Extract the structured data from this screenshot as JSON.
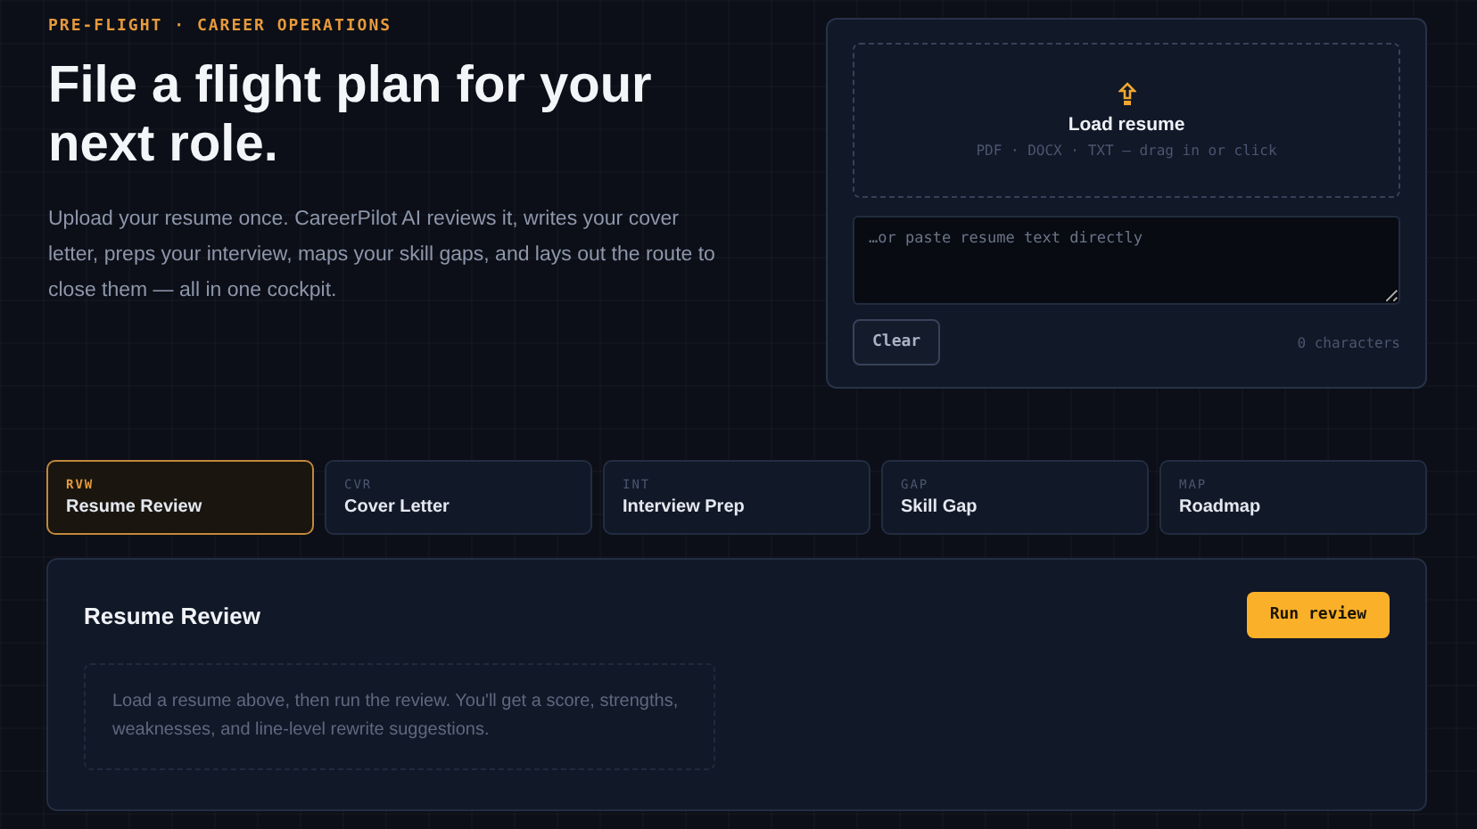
{
  "hero": {
    "eyebrow": "PRE-FLIGHT · CAREER OPERATIONS",
    "title": "File a flight plan for your next role.",
    "intro": "Upload your resume once. CareerPilot AI reviews it, writes your cover letter, preps your interview, maps your skill gaps, and lays out the route to close them — all in one cockpit."
  },
  "upload": {
    "title": "Load resume",
    "hint": "PDF · DOCX · TXT — drag in or click",
    "placeholder": "…or paste resume text directly",
    "clear": "Clear",
    "count": "0 characters"
  },
  "tabs": [
    {
      "code": "RVW",
      "label": "Resume Review",
      "selected": true
    },
    {
      "code": "CVR",
      "label": "Cover Letter",
      "selected": false
    },
    {
      "code": "INT",
      "label": "Interview Prep",
      "selected": false
    },
    {
      "code": "GAP",
      "label": "Skill Gap",
      "selected": false
    },
    {
      "code": "MAP",
      "label": "Roadmap",
      "selected": false
    }
  ],
  "panel": {
    "title": "Resume Review",
    "action": "Run review",
    "empty": "Load a resume above, then run the review. You'll get a score, strengths, weaknesses, and line-level rewrite suggestions."
  }
}
